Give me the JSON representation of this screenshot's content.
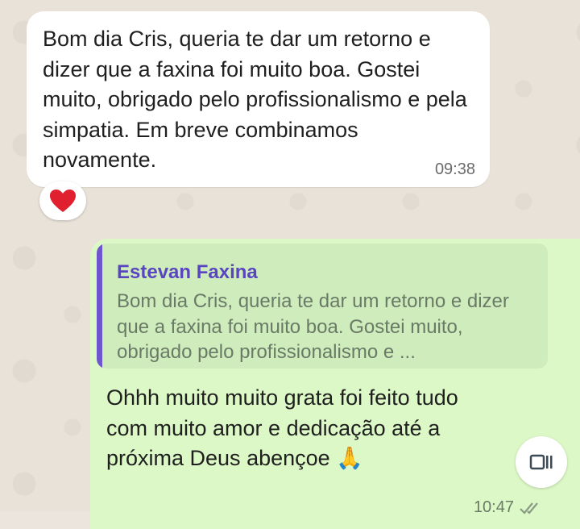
{
  "incoming_message": {
    "text": "Bom dia Cris, queria te dar um retorno e dizer que a faxina foi muito boa. Gostei muito, obrigado pelo profissionalismo e pela simpatia. Em breve combinamos novamente.",
    "time": "09:38",
    "reaction": "❤️"
  },
  "outgoing_message": {
    "quoted": {
      "author": "Estevan Faxina",
      "text": "Bom dia Cris, queria te dar um retorno e dizer que a faxina foi muito boa. Gostei muito, obrigado pelo profissionalismo e ..."
    },
    "text": "Ohhh muito muito grata  foi feito tudo com muito amor e dedicação até  a próxima Deus abençoe 🙏",
    "time": "10:47",
    "status_icon": "double-check-icon"
  },
  "colors": {
    "incoming_bubble": "#ffffff",
    "outgoing_bubble": "#dcf8c6",
    "quote_accent": "#6e56cf",
    "background": "#e9e2d8"
  }
}
